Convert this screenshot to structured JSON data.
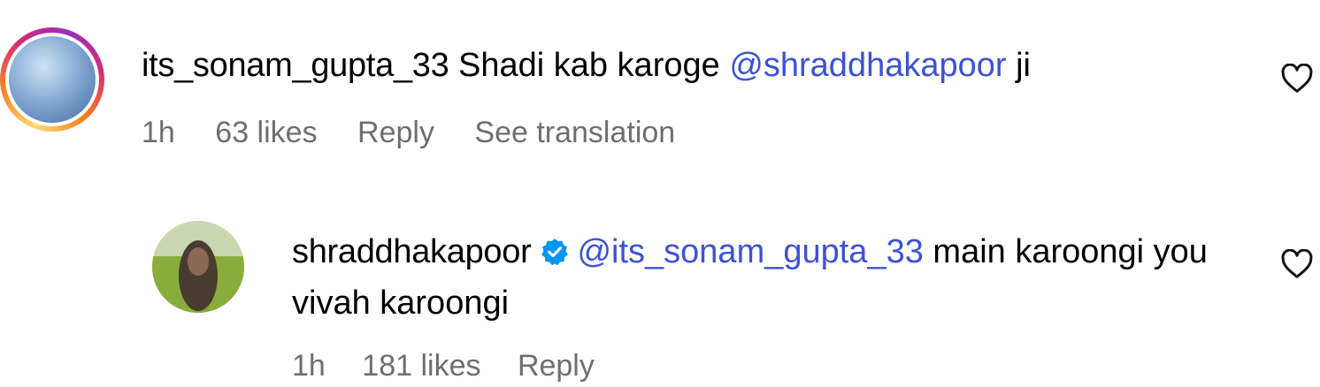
{
  "comments": [
    {
      "username": "its_sonam_gupta_33",
      "text": "Shadi kab karoge",
      "mention": "@shraddhakapoor",
      "text_after": "ji",
      "time": "1h",
      "likes": "63 likes",
      "reply_label": "Reply",
      "translation_label": "See translation"
    },
    {
      "username": "shraddhakapoor",
      "mention": "@its_sonam_gupta_33",
      "text": "main karoongi you vivah karoongi",
      "time": "1h",
      "likes": "181 likes",
      "reply_label": "Reply"
    }
  ],
  "icons": {
    "like": "heart-outline-icon",
    "verified": "verified-badge-icon"
  },
  "colors": {
    "mention": "#3b52d6",
    "meta": "#6e6e6e",
    "verified": "#0095f6"
  }
}
